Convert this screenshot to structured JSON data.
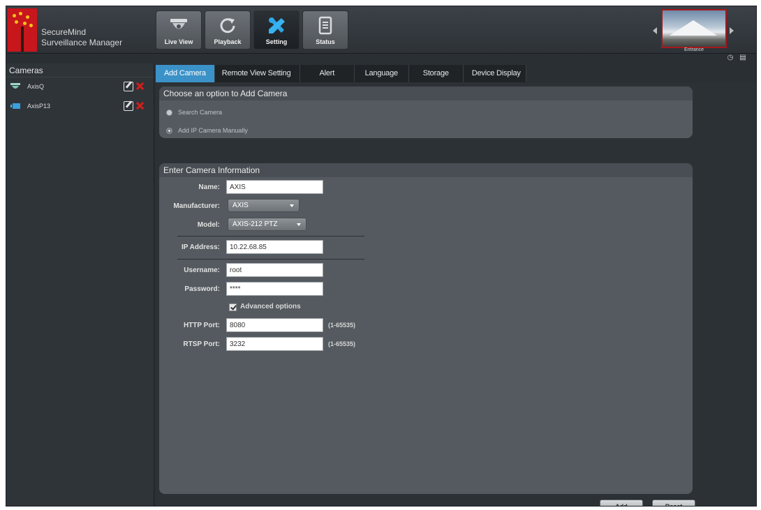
{
  "app": {
    "name_line1": "SecureMind",
    "name_line2": "Surveillance Manager"
  },
  "toolbar": {
    "items": [
      {
        "label": "Live View",
        "icon": "dome-camera-icon"
      },
      {
        "label": "Playback",
        "icon": "refresh-icon"
      },
      {
        "label": "Setting",
        "icon": "tools-icon"
      },
      {
        "label": "Status",
        "icon": "document-icon"
      }
    ],
    "active": "Setting"
  },
  "preview": {
    "label": "Entrance"
  },
  "sidebar": {
    "title": "Cameras",
    "cameras": [
      {
        "name": "AxisQ",
        "icon": "dome-camera-icon"
      },
      {
        "name": "AxisP13",
        "icon": "box-camera-icon"
      }
    ]
  },
  "tabs": {
    "items": [
      "Add Camera",
      "Remote View Setting",
      "Alert",
      "Language",
      "Storage",
      "Device Display"
    ],
    "active": "Add Camera"
  },
  "choose_panel": {
    "title": "Choose an option to Add Camera",
    "options": [
      "Search Camera",
      "Add IP Camera Manually"
    ],
    "selected": "Add IP Camera Manually"
  },
  "info_panel": {
    "title": "Enter Camera Information",
    "name_label": "Name:",
    "name_value": "AXIS",
    "manufacturer_label": "Manufacturer:",
    "manufacturer_value": "AXIS",
    "model_label": "Model:",
    "model_value": "AXIS-212 PTZ",
    "ip_label": "IP Address:",
    "ip_value": "10.22.68.85",
    "username_label": "Username:",
    "username_value": "root",
    "password_label": "Password:",
    "password_value": "****",
    "advanced_label": "Advanced options",
    "advanced_checked": true,
    "http_label": "HTTP Port:",
    "http_value": "8080",
    "http_range": "(1-65535)",
    "rtsp_label": "RTSP Port:",
    "rtsp_value": "3232",
    "rtsp_range": "(1-65535)"
  },
  "actions": {
    "add_label": "Add",
    "reset_label": "Reset"
  },
  "colors": {
    "active_tab": "#3b92c8",
    "logo_red": "#c8161d",
    "delete_red": "#d51c1c"
  }
}
